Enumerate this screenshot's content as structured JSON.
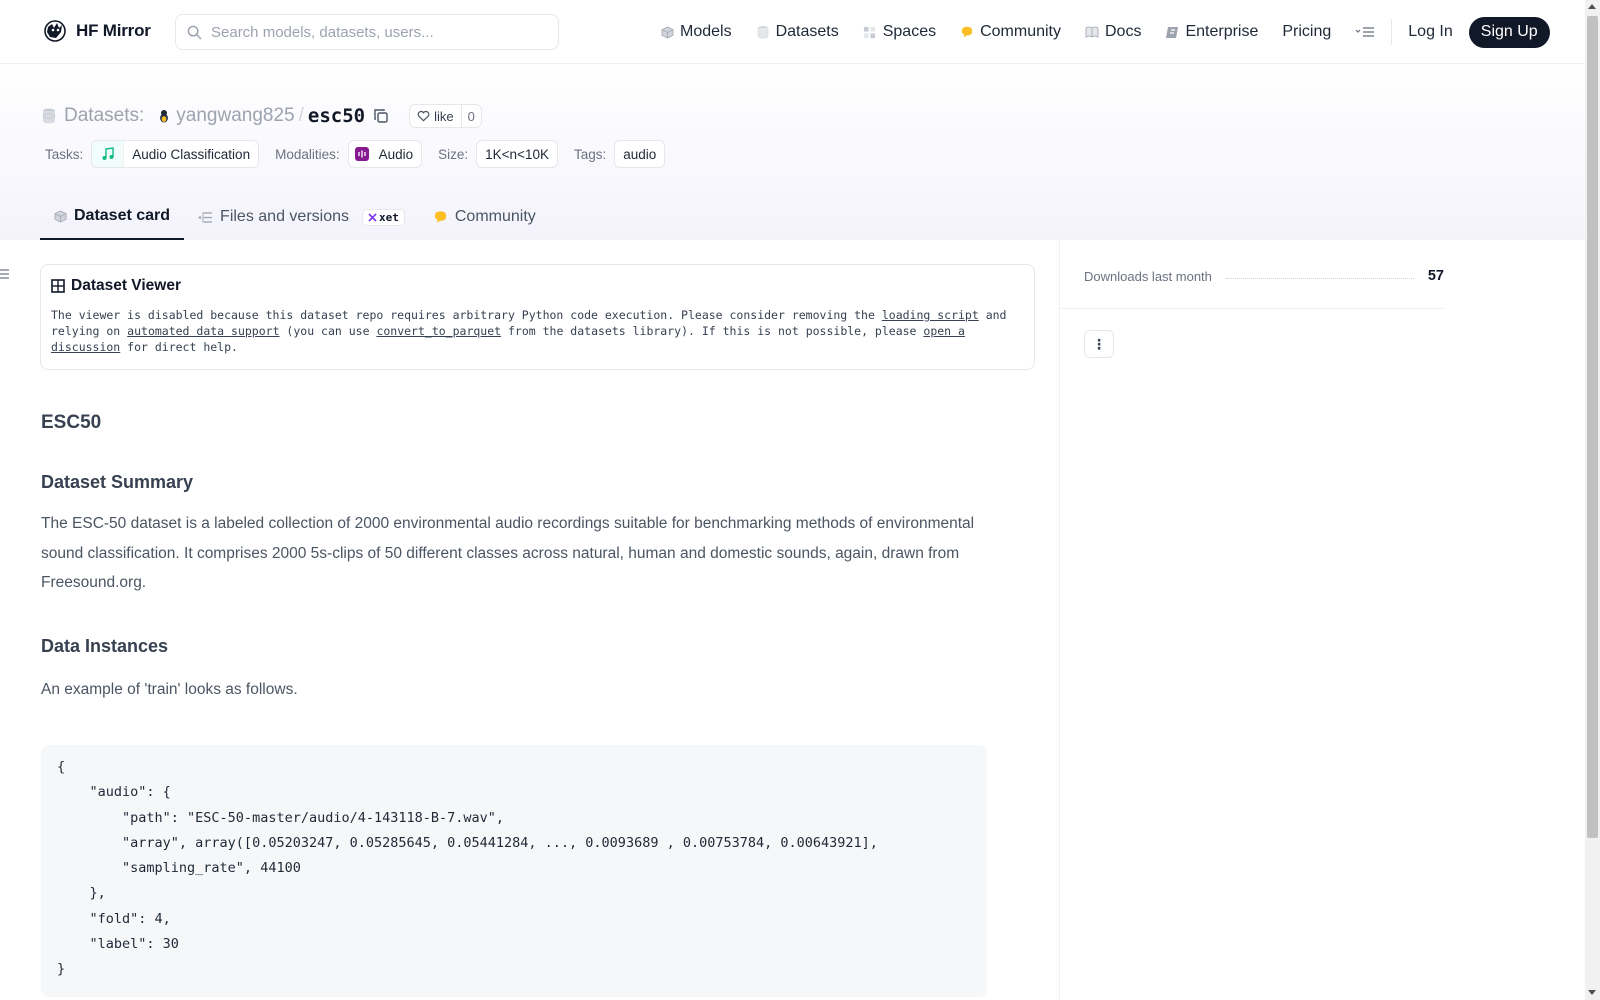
{
  "nav": {
    "brand": "HF Mirror",
    "search_placeholder": "Search models, datasets, users...",
    "links": [
      {
        "label": "Models",
        "icon": "cube-icon"
      },
      {
        "label": "Datasets",
        "icon": "database-icon"
      },
      {
        "label": "Spaces",
        "icon": "grid-icon"
      },
      {
        "label": "Community",
        "icon": "community-icon"
      },
      {
        "label": "Docs",
        "icon": "book-icon"
      },
      {
        "label": "Enterprise",
        "icon": "enterprise-icon"
      },
      {
        "label": "Pricing",
        "icon": ""
      }
    ],
    "login": "Log In",
    "signup": "Sign Up"
  },
  "header": {
    "section_label": "Datasets:",
    "owner": "yangwang825",
    "separator": "/",
    "name": "esc50",
    "like_label": "like",
    "like_count": "0",
    "tags": {
      "tasks_label": "Tasks:",
      "task": "Audio Classification",
      "modalities_label": "Modalities:",
      "modality": "Audio",
      "size_label": "Size:",
      "size": "1K<n<10K",
      "tags_label": "Tags:",
      "tag": "audio"
    },
    "tabs": [
      {
        "label": "Dataset card",
        "active": true
      },
      {
        "label": "Files and versions",
        "badge": "xet"
      },
      {
        "label": "Community"
      }
    ]
  },
  "viewer": {
    "title": "Dataset Viewer",
    "msg_1": "The viewer is disabled because this dataset repo requires arbitrary Python code execution. Please consider removing the ",
    "link_1": "loading script",
    "msg_2": " and relying on ",
    "link_2": "automated data support",
    "msg_3": " (you can use ",
    "link_3": "convert_to_parquet",
    "msg_4": " from the datasets library). If this is not possible, please ",
    "link_4": "open a discussion",
    "msg_5": " for direct help."
  },
  "card": {
    "title": "ESC50",
    "summary_heading": "Dataset Summary",
    "summary_text": "The ESC-50 dataset is a labeled collection of 2000 environmental audio recordings suitable for benchmarking methods of environmental sound classification. It comprises 2000 5s-clips of 50 different classes across natural, human and domestic sounds, again, drawn from Freesound.org.",
    "instances_heading": "Data Instances",
    "instances_text": "An example of 'train' looks as follows.",
    "code": "{\n    \"audio\": {\n        \"path\": \"ESC-50-master/audio/4-143118-B-7.wav\",\n        \"array\", array([0.05203247, 0.05285645, 0.05441284, ..., 0.0093689 , 0.00753784, 0.00643921],\n        \"sampling_rate\", 44100\n    },\n    \"fold\": 4,\n    \"label\": 30\n}"
  },
  "sidebar": {
    "downloads_label": "Downloads last month",
    "downloads_value": "57",
    "more_button": "⋮"
  },
  "colors": {
    "brand_dark": "#111827",
    "community_yellow": "#fbbf24",
    "audio_purple": "#9333ea",
    "task_green": "#10b981"
  }
}
